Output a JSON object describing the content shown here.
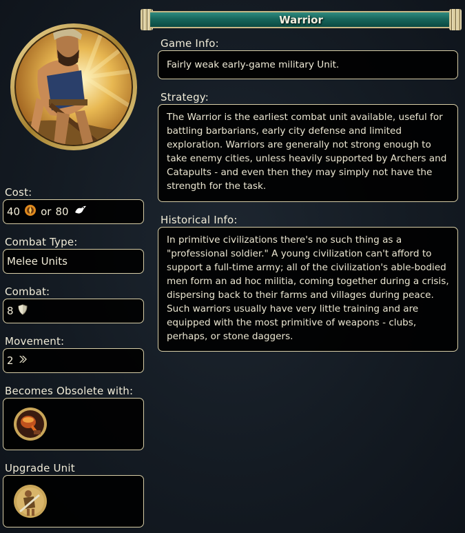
{
  "title": "Warrior",
  "game_info": {
    "label": "Game Info:",
    "text": "Fairly weak early-game military Unit."
  },
  "strategy": {
    "label": "Strategy:",
    "text": "The Warrior is the earliest combat unit available, useful for battling barbarians, early city defense and limited exploration. Warriors are generally not strong enough to take enemy cities, unless heavily supported by Archers and Catapults - and even then they may simply not have the strength for the task."
  },
  "historical": {
    "label": "Historical Info:",
    "text": "In primitive civilizations there's no such thing as a \"professional soldier.\" A young civilization can't afford to support a full-time army; all of the civilization's able-bodied men form an ad hoc militia, coming together during a crisis, dispersing back to their farms and villages during peace. Such warriors usually have very little training and are equipped with the most primitive of weapons - clubs, perhaps, or stone daggers."
  },
  "cost": {
    "label": "Cost:",
    "production": "40",
    "or": "or",
    "faith": "80",
    "production_icon": "production-icon",
    "faith_icon": "faith-icon"
  },
  "combat_type": {
    "label": "Combat Type:",
    "value": "Melee Units"
  },
  "combat": {
    "label": "Combat:",
    "value": "8",
    "icon": "shield-icon"
  },
  "movement": {
    "label": "Movement:",
    "value": "2",
    "icon": "movement-icon"
  },
  "obsolete": {
    "label": "Becomes Obsolete with:",
    "icon": "metal-casting-tech-icon"
  },
  "upgrade": {
    "label": "Upgrade Unit",
    "icon": "swordsman-unit-icon"
  },
  "colors": {
    "border": "#d9cfa8",
    "banner": "#17665c",
    "background": "#141b23"
  }
}
